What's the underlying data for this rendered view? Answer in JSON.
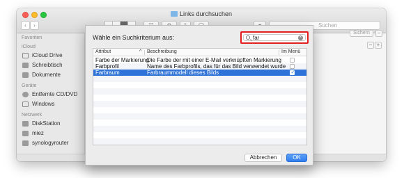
{
  "window": {
    "title": "Links durchsuchen"
  },
  "toolbar": {
    "search_placeholder": "Suchen",
    "nav_back": "‹",
    "nav_forward": "›"
  },
  "sidebar": {
    "sections": [
      {
        "header": "Favoriten",
        "items": []
      },
      {
        "header": "iCloud",
        "items": [
          {
            "label": "iCloud Drive",
            "icon": "cloud-icon"
          },
          {
            "label": "Schreibtisch",
            "icon": "desktop-icon"
          },
          {
            "label": "Dokumente",
            "icon": "documents-icon"
          }
        ]
      },
      {
        "header": "Geräte",
        "items": [
          {
            "label": "Entfernte CD/DVD",
            "icon": "disc-icon"
          },
          {
            "label": "Windows",
            "icon": "display-icon"
          }
        ]
      },
      {
        "header": "Netzwerk",
        "items": [
          {
            "label": "DiskStation",
            "icon": "server-icon"
          },
          {
            "label": "miez",
            "icon": "computer-icon"
          },
          {
            "label": "synologyrouter",
            "icon": "computer-icon"
          }
        ]
      }
    ]
  },
  "right_panel": {
    "sichern_label": "Sichern",
    "minus_label": "−",
    "plus_label": "+"
  },
  "dialog": {
    "prompt": "Wähle ein Suchkriterium aus:",
    "search_value": "far",
    "columns": [
      "Attribut",
      "Beschreibung",
      "Im Menü"
    ],
    "rows": [
      {
        "attribute": "Farbe der Markierung",
        "description": "Die Farbe der mit einer E-Mail verknüpften Markierung",
        "in_menu": false,
        "selected": false
      },
      {
        "attribute": "Farbprofil",
        "description": "Name des Farbprofils, das für das Bild verwendet wurde",
        "in_menu": false,
        "selected": false
      },
      {
        "attribute": "Farbraum",
        "description": "Farbraummodell dieses Bilds",
        "in_menu": true,
        "selected": true
      }
    ],
    "cancel_label": "Abbrechen",
    "ok_label": "OK"
  },
  "colors": {
    "selection": "#2f72d8",
    "highlight_border": "#e02020",
    "ok_button": "#2f7ef0"
  }
}
